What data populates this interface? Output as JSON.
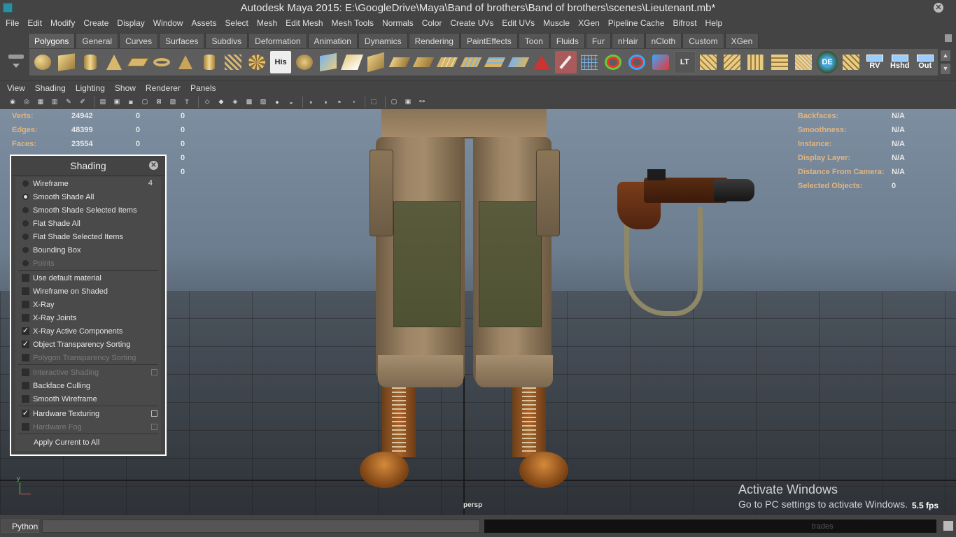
{
  "window": {
    "title": "Autodesk Maya 2015: E:\\GoogleDrive\\Maya\\Band of brothers\\Band of brothers\\scenes\\Lieutenant.mb*"
  },
  "menus": [
    "File",
    "Edit",
    "Modify",
    "Create",
    "Display",
    "Window",
    "Assets",
    "Select",
    "Mesh",
    "Edit Mesh",
    "Mesh Tools",
    "Normals",
    "Color",
    "Create UVs",
    "Edit UVs",
    "Muscle",
    "XGen",
    "Pipeline Cache",
    "Bifrost",
    "Help"
  ],
  "shelf": {
    "tabs": [
      "Polygons",
      "General",
      "Curves",
      "Surfaces",
      "Subdivs",
      "Deformation",
      "Animation",
      "Dynamics",
      "Rendering",
      "PaintEffects",
      "Toon",
      "Fluids",
      "Fur",
      "nHair",
      "nCloth",
      "Custom",
      "XGen"
    ],
    "active_tab": "Polygons",
    "icon_labels": {
      "history": "His",
      "lt": "LT",
      "de": "DE",
      "rv": "RV",
      "hshd": "Hshd",
      "out": "Out"
    }
  },
  "panel_menus": [
    "View",
    "Shading",
    "Lighting",
    "Show",
    "Renderer",
    "Panels"
  ],
  "hud": {
    "left": [
      {
        "label": "Verts:",
        "v1": "24942",
        "v2": "0",
        "v3": "0"
      },
      {
        "label": "Edges:",
        "v1": "48399",
        "v2": "0",
        "v3": "0"
      },
      {
        "label": "Faces:",
        "v1": "23554",
        "v2": "0",
        "v3": "0"
      },
      {
        "label": "",
        "v1": "",
        "v2": "",
        "v3": "0"
      },
      {
        "label": "",
        "v1": "",
        "v2": "",
        "v3": "0"
      }
    ],
    "right": [
      {
        "label": "Backfaces:",
        "value": "N/A"
      },
      {
        "label": "Smoothness:",
        "value": "N/A"
      },
      {
        "label": "Instance:",
        "value": "N/A"
      },
      {
        "label": "Display Layer:",
        "value": "N/A"
      },
      {
        "label": "Distance From Camera:",
        "value": "N/A"
      },
      {
        "label": "Selected Objects:",
        "value": "0"
      }
    ]
  },
  "shading_panel": {
    "title": "Shading",
    "items": [
      {
        "label": "Wireframe",
        "kind": "radio",
        "checked": false,
        "hotkey": "4"
      },
      {
        "label": "Smooth Shade All",
        "kind": "radio",
        "checked": true
      },
      {
        "label": "Smooth Shade Selected Items",
        "kind": "radio",
        "checked": false
      },
      {
        "label": "Flat Shade All",
        "kind": "radio",
        "checked": false
      },
      {
        "label": "Flat Shade Selected Items",
        "kind": "radio",
        "checked": false
      },
      {
        "label": "Bounding Box",
        "kind": "radio",
        "checked": false
      },
      {
        "label": "Points",
        "kind": "radio",
        "checked": false,
        "disabled": true
      },
      {
        "kind": "divider"
      },
      {
        "label": "Use default material",
        "kind": "check",
        "checked": false
      },
      {
        "label": "Wireframe on Shaded",
        "kind": "check",
        "checked": false
      },
      {
        "label": "X-Ray",
        "kind": "check",
        "checked": false
      },
      {
        "label": "X-Ray Joints",
        "kind": "check",
        "checked": false
      },
      {
        "label": "X-Ray Active Components",
        "kind": "check",
        "checked": true
      },
      {
        "label": "Object Transparency Sorting",
        "kind": "check",
        "checked": true
      },
      {
        "label": "Polygon Transparency Sorting",
        "kind": "check",
        "checked": false,
        "disabled": true
      },
      {
        "kind": "divider"
      },
      {
        "label": "Interactive Shading",
        "kind": "check",
        "checked": false,
        "disabled": true,
        "option_box": true
      },
      {
        "label": "Backface Culling",
        "kind": "check",
        "checked": false
      },
      {
        "label": "Smooth Wireframe",
        "kind": "check",
        "checked": false
      },
      {
        "kind": "divider"
      },
      {
        "label": "Hardware Texturing",
        "kind": "check",
        "checked": true,
        "option_box": true
      },
      {
        "label": "Hardware Fog",
        "kind": "check",
        "checked": false,
        "disabled": true,
        "option_box": true
      },
      {
        "kind": "divider"
      },
      {
        "label": "Apply Current to All",
        "kind": "action"
      }
    ]
  },
  "viewport": {
    "camera": "persp",
    "fps": "5.5 fps",
    "axis_label": "y",
    "watermark": {
      "line1": "Activate Windows",
      "line2": "Go to PC settings to activate Windows."
    }
  },
  "command_line": {
    "language": "Python",
    "result_label": "trades"
  }
}
